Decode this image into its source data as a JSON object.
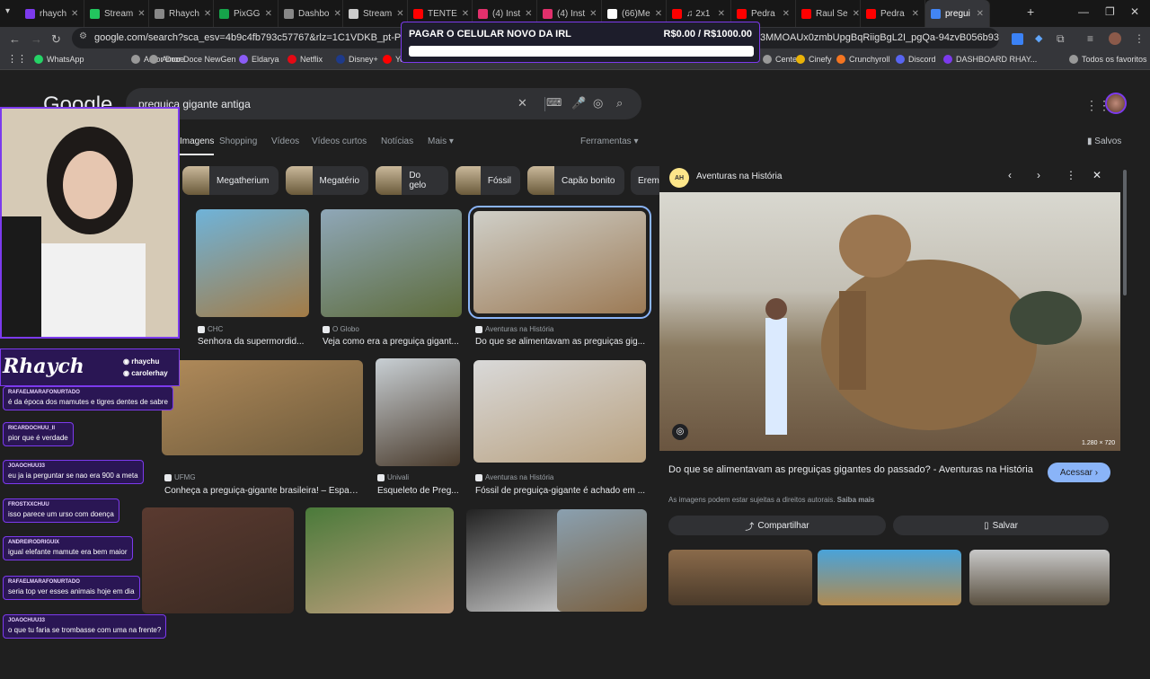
{
  "tabs": [
    {
      "label": "rhaych",
      "color": "#7c3aed"
    },
    {
      "label": "Stream",
      "color": "#22c55e"
    },
    {
      "label": "Rhaych",
      "color": "#888888"
    },
    {
      "label": "PixGG",
      "color": "#16a34a"
    },
    {
      "label": "Dashbo",
      "color": "#888888"
    },
    {
      "label": "Stream",
      "color": "#cccccc"
    },
    {
      "label": "TENTE",
      "color": "#ff0000"
    },
    {
      "label": "(4) Inst",
      "color": "#e1306c"
    },
    {
      "label": "(4) Inst",
      "color": "#e1306c"
    },
    {
      "label": "(66)Me",
      "color": "#ffffff"
    },
    {
      "label": "♫ 2x1",
      "color": "#ff0000"
    },
    {
      "label": "Pedra",
      "color": "#ff0000"
    },
    {
      "label": "Raul Se",
      "color": "#ff0000"
    },
    {
      "label": "Pedra",
      "color": "#ff0000"
    },
    {
      "label": "pregui",
      "color": "#4285f4"
    }
  ],
  "url": "google.com/search?sca_esv=4b9c4fb793c57767&rlz=1C1VDKB_pt-PTBR1166BR11",
  "url_tail": "3MMOAUx0zmbUpgBqRiigBgL2I_pgQa-94zvB056b93wK...",
  "bookmarks": [
    {
      "label": "WhatsApp",
      "color": "#25d366"
    },
    {
      "label": "Amor Doce",
      "color": "#999999"
    },
    {
      "label": "Amor Doce NewGen",
      "color": "#999999"
    },
    {
      "label": "Eldarya",
      "color": "#8b5cf6"
    },
    {
      "label": "Netflix",
      "color": "#e50914"
    },
    {
      "label": "Disney+",
      "color": "#1e3a8a"
    },
    {
      "label": "Yo",
      "color": "#ff0000"
    },
    {
      "label": "Center",
      "color": "#999999"
    },
    {
      "label": "Cinefy",
      "color": "#eab308"
    },
    {
      "label": "Crunchyroll",
      "color": "#f47521"
    },
    {
      "label": "Discord",
      "color": "#5865f2"
    },
    {
      "label": "DASHBOARD RHAY...",
      "color": "#7c3aed"
    },
    {
      "label": "Todos os favoritos",
      "color": "#999999"
    }
  ],
  "goal": {
    "title": "PAGAR O CELULAR NOVO DA IRL",
    "value": "R$0.00 / R$1000.00",
    "progress": 0
  },
  "google": {
    "logo": "Google",
    "query": "preguiça gigante antiga",
    "filters": [
      "Imagens",
      "Shopping",
      "Vídeos",
      "Vídeos curtos",
      "Notícias",
      "Mais",
      "Ferramentas"
    ],
    "saved": "Salvos",
    "chips": [
      "Megatherium",
      "Megatério",
      "Do gelo",
      "Fóssil",
      "Capão bonito",
      "Erem"
    ],
    "results": [
      {
        "source": "CHC",
        "caption": "Senhora da supermordid...",
        "c1": "#6fb3d9",
        "c2": "#a37b45"
      },
      {
        "source": "O Globo",
        "caption": "Veja como era a preguiça gigant...",
        "c1": "#8fa7b8",
        "c2": "#5d6b3a"
      },
      {
        "source": "Aventuras na História",
        "caption": "Do que se alimentavam as preguiças gig...",
        "c1": "#cfcfc8",
        "c2": "#9c7a55"
      },
      {
        "source": "UFMG",
        "caption": "Conheça a preguiça-gigante brasileira! – Espaço...",
        "c1": "#b08a5a",
        "c2": "#6d5a3b"
      },
      {
        "source": "Univali",
        "caption": "Esqueleto de Preg...",
        "c1": "#c8cfd4",
        "c2": "#4a3b2c"
      },
      {
        "source": "Aventuras na História",
        "caption": "Fóssil de preguiça-gigante é achado em ...",
        "c1": "#d9d9d9",
        "c2": "#b8a07e"
      },
      {
        "source": "",
        "caption": "",
        "c1": "#5a3a30",
        "c2": "#3a2a22"
      },
      {
        "source": "",
        "caption": "",
        "c1": "#4a7a3a",
        "c2": "#c4a080"
      },
      {
        "source": "",
        "caption": "",
        "c1": "#222222",
        "c2": "#e6e6e6"
      },
      {
        "source": "",
        "caption": "",
        "c1": "#8aa0b0",
        "c2": "#7a6040"
      }
    ],
    "panel": {
      "site": "Aventuras na História",
      "site_badge": "AH",
      "dims": "1.280 × 720",
      "title": "Do que se alimentavam as preguiças gigantes do passado? - Aventuras na História",
      "visit": "Acessar",
      "notice": "As imagens podem estar sujeitas a direitos autorais.",
      "more": "Saiba mais",
      "share": "Compartilhar",
      "save": "Salvar"
    }
  },
  "overlay": {
    "logo": "Rhaych",
    "handle1": "rhaychu",
    "handle2": "carolerhay",
    "chat": [
      {
        "user": "RAFAELMARAFONURTADO",
        "text": "é da época dos mamutes e tigres dentes de sabre"
      },
      {
        "user": "RICARDOCHUU_II",
        "text": "pior que é verdade"
      },
      {
        "user": "JOAOCHUU33",
        "text": "eu ja ia perguntar se nao era 900 a meta"
      },
      {
        "user": "FROSTXXCHUU",
        "text": "isso parece um urso com doença"
      },
      {
        "user": "ANDREIRODRIGUIX",
        "text": "igual elefante mamute era bem maior"
      },
      {
        "user": "RAFAELMARAFONURTADO",
        "text": "seria top ver esses animais hoje em dia"
      },
      {
        "user": "JOAOCHUU33",
        "text": "o que tu faria se trombasse com uma na frente?"
      }
    ]
  },
  "colors": {
    "accent": "#7c3aed",
    "link_blue": "#8ab4f8",
    "button_blue": "#8ab4f8"
  }
}
